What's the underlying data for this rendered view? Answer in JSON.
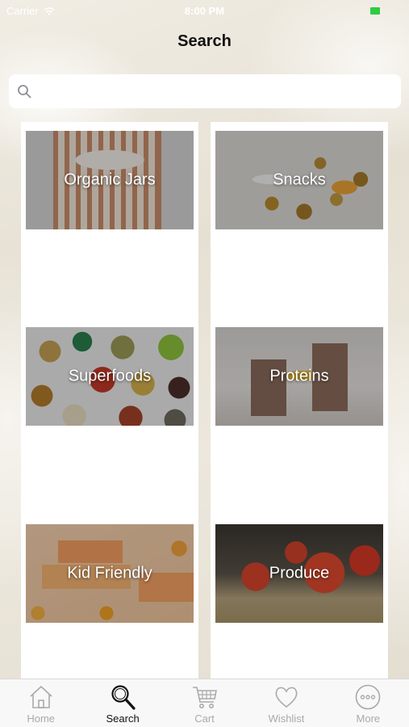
{
  "status_bar": {
    "carrier": "Carrier",
    "time": "8:00 PM"
  },
  "nav": {
    "title": "Search"
  },
  "search": {
    "placeholder": "",
    "value": ""
  },
  "categories": {
    "left": [
      {
        "label": "Organic Jars"
      },
      {
        "label": "Superfoods"
      },
      {
        "label": "Kid Friendly"
      }
    ],
    "right": [
      {
        "label": "Snacks"
      },
      {
        "label": "Proteins"
      },
      {
        "label": "Produce"
      }
    ]
  },
  "tab_bar": {
    "items": [
      {
        "label": "Home",
        "icon": "home-icon"
      },
      {
        "label": "Search",
        "icon": "search-icon"
      },
      {
        "label": "Cart",
        "icon": "cart-icon"
      },
      {
        "label": "Wishlist",
        "icon": "heart-icon"
      },
      {
        "label": "More",
        "icon": "more-icon"
      }
    ],
    "active": "Search"
  },
  "colors": {
    "active_tab": "#111111",
    "inactive_tab": "#aaaaaa",
    "battery": "#2ecc40"
  }
}
